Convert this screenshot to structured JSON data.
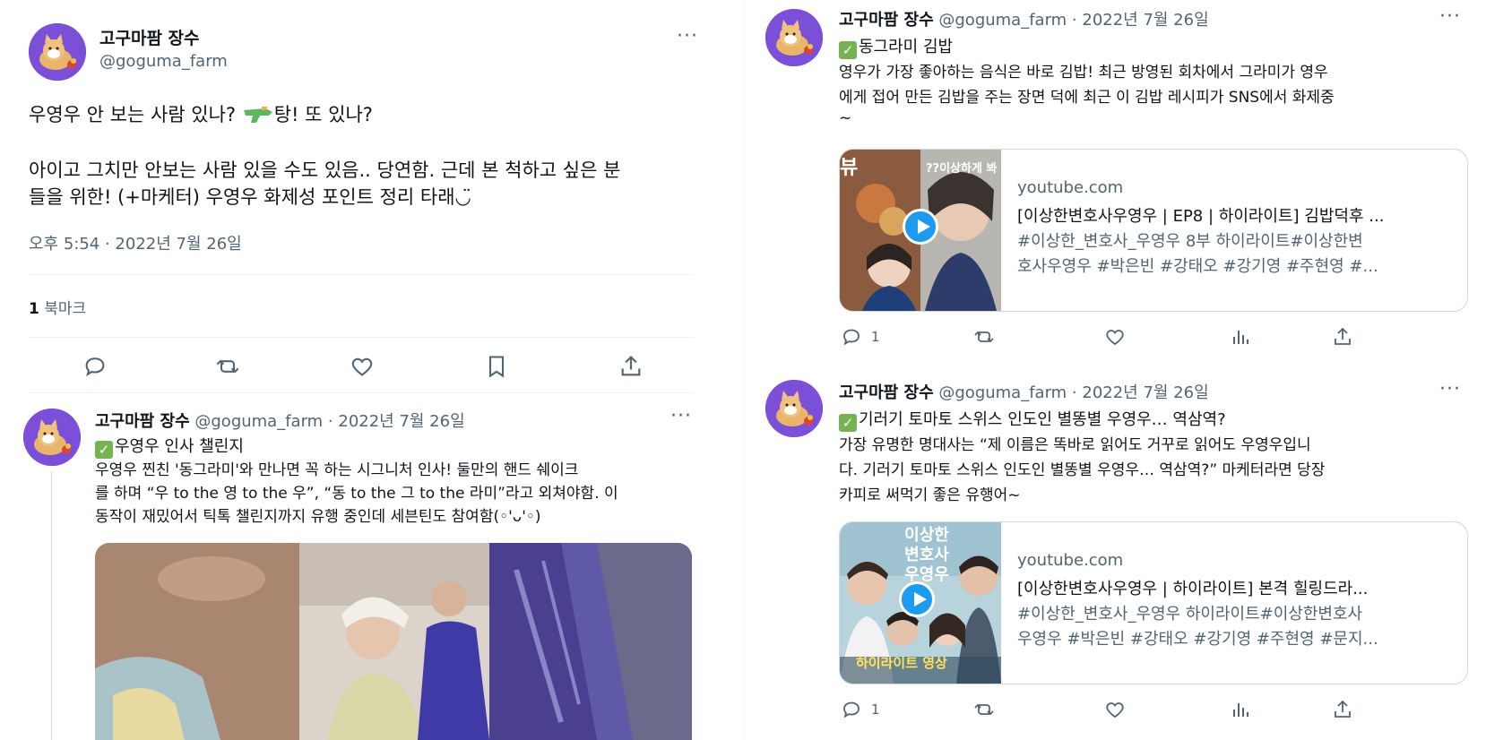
{
  "main_tweet": {
    "name": "고구마팜 장수",
    "handle": "@goguma_farm",
    "more": "···",
    "line1_a": "우영우 안 보는 사람 있나? ",
    "line1_b": "탕! 또 있나?",
    "line2": "아이고 그치만 안보는 사람 있을 수도 있음.. 당연함. 근데 본 척하고 싶은 분",
    "line3": "들을 위한! (+마케터) 우영우 화제성 포인트 정리 타래◡̈",
    "timestamp": "오후 5:54 · 2022년 7월 26일",
    "bookmark_count": "1",
    "bookmark_label": " 북마크",
    "icons": [
      "reply-icon",
      "retweet-icon",
      "like-icon",
      "bookmark-icon",
      "share-icon"
    ]
  },
  "reply_left": {
    "name": "고구마팜 장수",
    "meta": "@goguma_farm · 2022년 7월 26일",
    "more": "···",
    "title": "우영우 인사 챌린지",
    "lines": [
      "우영우 찐친 '동그라미'와 만나면 꼭 하는 시그니처 인사! 둘만의 핸드 쉐이크",
      "를 하며 “우 to the 영 to the 우”, “동 to the 그 to the 라미”라고 외쳐야함. 이",
      "동작이 재밌어서 틱톡 챌린지까지 유행 중인데 세븐틴도 참여함(◦'ᴗ'◦)"
    ]
  },
  "reply_right_1": {
    "name": "고구마팜 장수",
    "meta": "@goguma_farm · 2022년 7월 26일",
    "more": "···",
    "title": "동그라미 김밥",
    "lines": [
      "영우가 가장 좋아하는 음식은 바로 김밥! 최근 방영된 회차에서 그라미가 영우",
      "에게 접어 만든 김밥을 주는 장면 덕에 최근 이 김밥 레시피가 SNS에서 화제중",
      "~"
    ],
    "card": {
      "domain": "youtube.com",
      "title": "[이상한변호사우영우 | EP8 | 하이라이트] 김밥덕후 ...",
      "desc1": "#이상한_변호사_우영우 8부 하이라이트#이상한변",
      "desc2": "호사우영우 #박은빈 #강태오 #강기영 #주현영 #...",
      "thumb_text": "??이상하게 봐",
      "thumb_tag": "뷰"
    },
    "reply_count": "1"
  },
  "reply_right_2": {
    "name": "고구마팜 장수",
    "meta": "@goguma_farm · 2022년 7월 26일",
    "more": "···",
    "title": "기러기 토마토 스위스 인도인 별똥별 우영우… 역삼역?",
    "lines": [
      "가장 유명한 명대사는 “제 이름은 똑바로 읽어도 거꾸로 읽어도 우영우입니",
      "다. 기러기 토마토 스위스 인도인 별똥별 우영우… 역삼역?” 마케터라면 당장",
      "카피로 써먹기 좋은 유행어~"
    ],
    "card": {
      "domain": "youtube.com",
      "title": "[이상한변호사우영우 | 하이라이트] 본격 힐링드라...",
      "desc1": "#이상한_변호사_우영우 하이라이트#이상한변호사",
      "desc2": "우영우 #박은빈 #강태오 #강기영 #주현영 #문지...",
      "thumb_text": "이상한 변호사 우영우",
      "thumb_tag": "하이라이트 영상"
    },
    "reply_count": "1"
  },
  "colors": {
    "accent": "#1d9bf0",
    "avatar_bg": "#7b4fd8",
    "muted": "#536471",
    "check": "#77b255"
  }
}
